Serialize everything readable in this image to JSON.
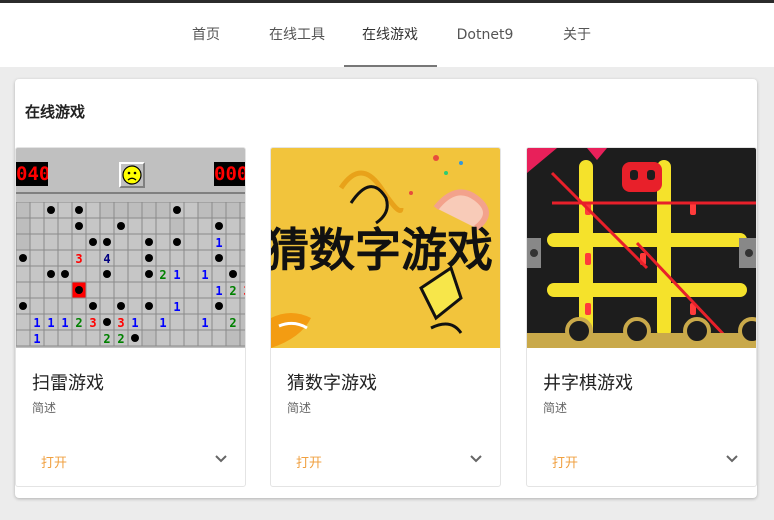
{
  "nav": {
    "items": [
      {
        "label": "首页"
      },
      {
        "label": "在线工具"
      },
      {
        "label": "在线游戏"
      },
      {
        "label": "Dotnet9"
      },
      {
        "label": "关于"
      }
    ],
    "active_index": 2
  },
  "section": {
    "title": "在线游戏"
  },
  "games": [
    {
      "title": "扫雷游戏",
      "desc": "简述",
      "open_label": "打开",
      "counter_left": "040",
      "counter_right": "000"
    },
    {
      "title": "猜数字游戏",
      "desc": "简述",
      "open_label": "打开",
      "banner_text": "猜数字游戏"
    },
    {
      "title": "井字棋游戏",
      "desc": "简述",
      "open_label": "打开"
    }
  ],
  "colors": {
    "accent_open": "#f0a040",
    "nav_underline": "#777777",
    "banner_yellow": "#f2c43c",
    "ttt_yellow": "#f5e22b",
    "ttt_red": "#e8202a"
  },
  "icons": {
    "expand": "chevron-down-icon",
    "face": "smiley-face-icon"
  }
}
